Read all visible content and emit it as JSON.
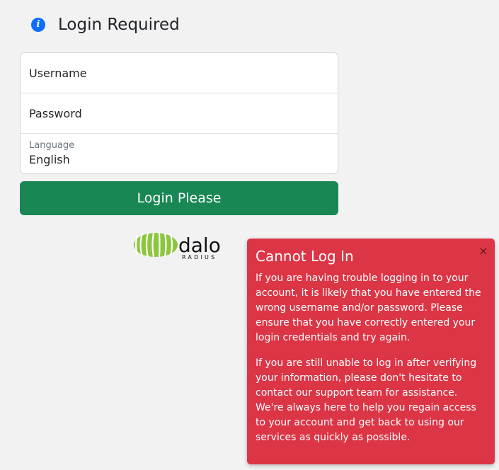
{
  "header": {
    "icon": "info-icon",
    "icon_glyph": "i",
    "title": "Login Required"
  },
  "form": {
    "username_placeholder": "Username",
    "password_placeholder": "Password",
    "language_label": "Language",
    "language_value": "English",
    "submit_label": "Login Please"
  },
  "logo": {
    "text": "dalo",
    "subtext": "RADIUS"
  },
  "alert": {
    "title": "Cannot Log In",
    "close_glyph": "×",
    "paragraph1": "If you are having trouble logging in to your account, it is likely that you have entered the wrong username and/or password. Please ensure that you have correctly entered your login credentials and try again.",
    "paragraph2": "If you are still unable to log in after verifying your information, please don't hesitate to contact our support team for assistance. We're always here to help you regain access to your account and get back to using our services as quickly as possible."
  },
  "colors": {
    "primary_icon": "#0d6efd",
    "submit_button": "#198754",
    "alert_background": "#dc3545",
    "logo_green": "#8cc63f"
  }
}
